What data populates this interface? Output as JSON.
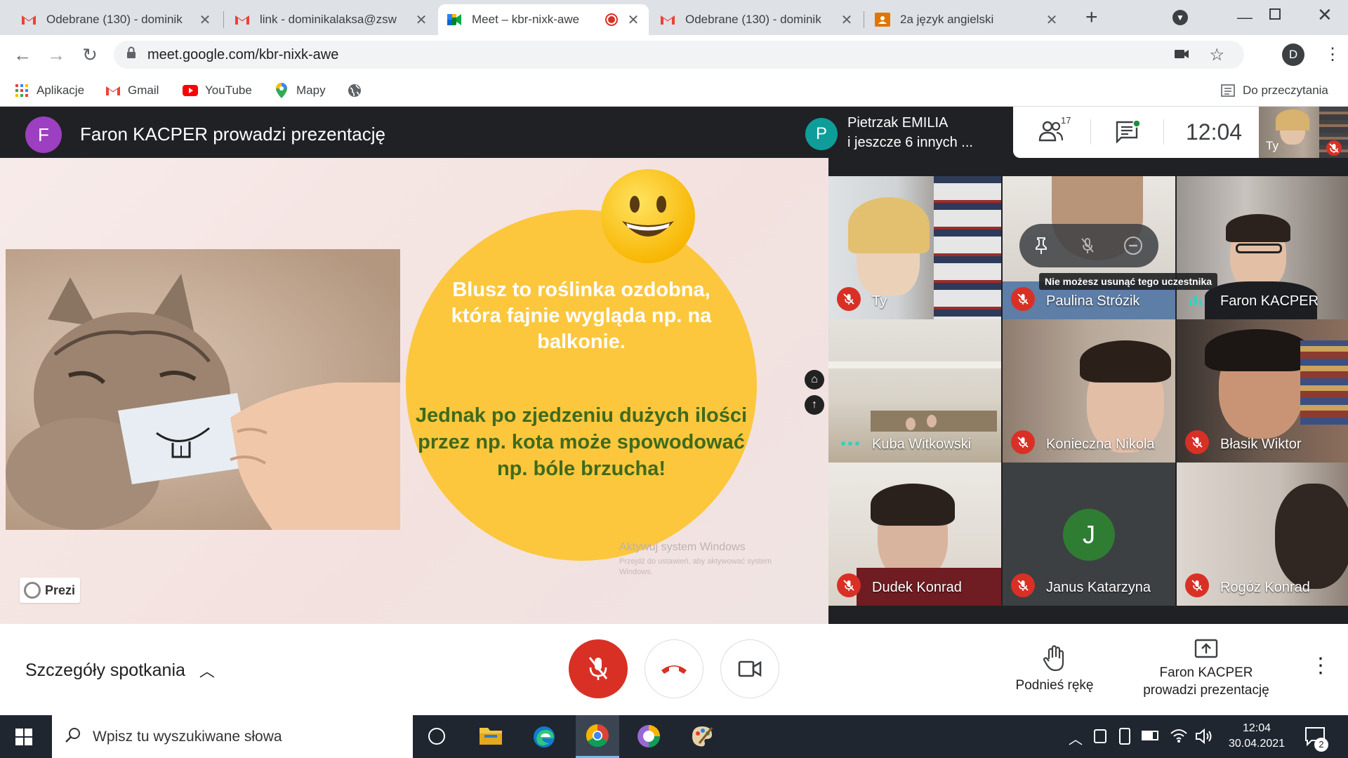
{
  "browser": {
    "tabs": [
      {
        "title": "Odebrane (130) - dominik",
        "icon": "gmail-icon"
      },
      {
        "title": "link - dominikalaksa@zsw",
        "icon": "gmail-icon"
      },
      {
        "title": "Meet – kbr-nixk-awe",
        "icon": "meet-icon",
        "active": true
      },
      {
        "title": "Odebrane (130) - dominik",
        "icon": "gmail-icon"
      },
      {
        "title": "2a język angielski",
        "icon": "classroom-icon"
      }
    ],
    "url": "meet.google.com/kbr-nixk-awe",
    "profile_initial": "D",
    "bookmarks": [
      {
        "label": "Aplikacje",
        "icon": "apps-grid-icon"
      },
      {
        "label": "Gmail",
        "icon": "gmail-icon"
      },
      {
        "label": "YouTube",
        "icon": "youtube-icon"
      },
      {
        "label": "Mapy",
        "icon": "maps-pin-icon"
      }
    ],
    "reading_list": "Do przeczytania"
  },
  "meet": {
    "presenter_initial": "F",
    "presenter_banner": "Faron KACPER prowadzi prezentację",
    "speaker_initial": "P",
    "speaker_line1": "Pietrzak EMILIA",
    "speaker_line2": "i jeszcze 6 innych ...",
    "participants_count": "17",
    "clock": "12:04",
    "self_label": "Ty",
    "slide": {
      "text1": "Blusz to roślinka ozdobna, która fajnie wygląda np. na balkonie.",
      "text2": "Jednak po zjedzeniu dużych ilości przez np. kota może spowodować np. bóle brzucha!",
      "brand": "Prezi",
      "watermark_title": "Aktywuj system Windows",
      "watermark_sub": "Przejdź do ustawień, aby aktywować system Windows."
    },
    "tooltip": "Nie możesz usunąć tego uczestnika",
    "tiles": [
      {
        "name": "Ty",
        "muted": true
      },
      {
        "name": "Paulina Strózik",
        "muted": true
      },
      {
        "name": "Faron KACPER",
        "muted": false
      },
      {
        "name": "Kuba Witkowski",
        "muted": false
      },
      {
        "name": "Konieczna Nikola",
        "muted": true
      },
      {
        "name": "Błasik Wiktor",
        "muted": true
      },
      {
        "name": "Dudek Konrad",
        "muted": true
      },
      {
        "name": "Janus Katarzyna",
        "muted": true,
        "initial": "J"
      },
      {
        "name": "Rogóż Konrad",
        "muted": true
      }
    ],
    "details_label": "Szczegóły spotkania",
    "raise_hand_label": "Podnieś rękę",
    "presenting_line1": "Faron KACPER",
    "presenting_line2": "prowadzi prezentację"
  },
  "taskbar": {
    "search_placeholder": "Wpisz tu wyszukiwane słowa",
    "time": "12:04",
    "date": "30.04.2021",
    "notifications": "2"
  },
  "colors": {
    "red": "#d93025",
    "meet_dark": "#202124",
    "slide_circle": "#fcc73d",
    "slide_text1": "#ffffff",
    "slide_text2": "#3f6a1c"
  }
}
